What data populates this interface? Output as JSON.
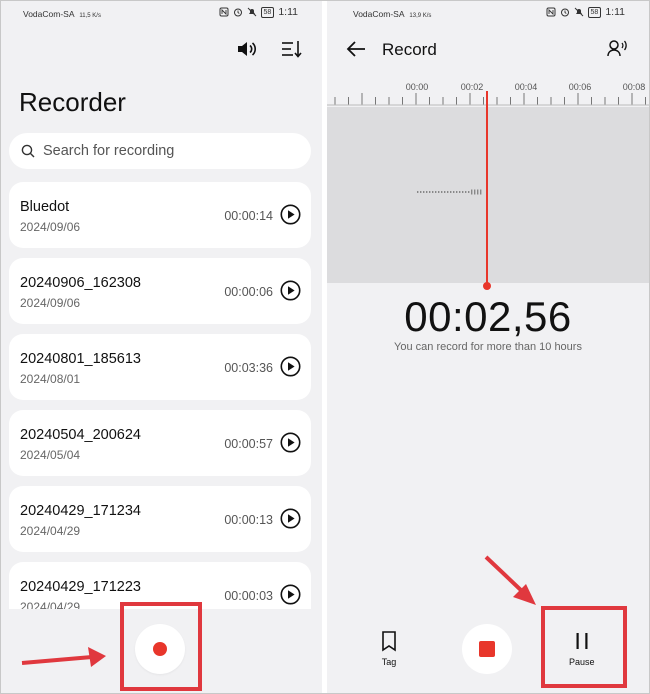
{
  "status_bar": {
    "left": {
      "carrier": "VodaCom-SA",
      "speed": "11,5 K/s",
      "battery": "58",
      "time": "1:11"
    },
    "right": {
      "carrier": "VodaCom-SA",
      "speed": "13,9 K/s",
      "battery": "58",
      "time": "1:11"
    }
  },
  "recorder": {
    "title": "Recorder",
    "search_placeholder": "Search for recording",
    "recordings": [
      {
        "name": "Bluedot",
        "date": "2024/09/06",
        "duration": "00:00:14"
      },
      {
        "name": "20240906_162308",
        "date": "2024/09/06",
        "duration": "00:00:06"
      },
      {
        "name": "20240801_185613",
        "date": "2024/08/01",
        "duration": "00:03:36"
      },
      {
        "name": "20240504_200624",
        "date": "2024/05/04",
        "duration": "00:00:57"
      },
      {
        "name": "20240429_171234",
        "date": "2024/04/29",
        "duration": "00:00:13"
      },
      {
        "name": "20240429_171223",
        "date": "2024/04/29",
        "duration": "00:00:03"
      }
    ]
  },
  "record_screen": {
    "title": "Record",
    "timeline_ticks": [
      "00:00",
      "00:02",
      "00:04",
      "00:06",
      "00:08"
    ],
    "timer": "00:02,56",
    "hint": "You can record for more than 10 hours",
    "controls": {
      "tag_label": "Tag",
      "pause_label": "Pause"
    }
  },
  "colors": {
    "accent": "#e8362b",
    "annotation": "#e0383e",
    "background": "#f1f1f3"
  }
}
